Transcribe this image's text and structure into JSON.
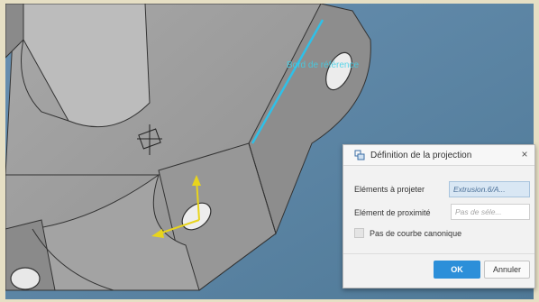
{
  "viewport": {
    "edge_label": "Bord de référence"
  },
  "dialog": {
    "title": "Définition de la projection",
    "close_glyph": "×",
    "fields": [
      {
        "label": "Eléments à projeter",
        "value": "Extrusion.6/A...",
        "placeholder": ""
      },
      {
        "label": "Elément de proximité",
        "value": "",
        "placeholder": "Pas de séle..."
      }
    ],
    "checkbox_label": "Pas de courbe canonique",
    "checkbox_checked": false,
    "ok_label": "OK",
    "cancel_label": "Annuler",
    "icons": {
      "title": "projection-icon",
      "close": "close-icon"
    }
  },
  "colors": {
    "background": "#5e88a9",
    "part": "#9c9c9c",
    "highlight_edge": "#2fc0e8",
    "axis": "#e8d41c",
    "ok_button": "#2c8fd9"
  }
}
